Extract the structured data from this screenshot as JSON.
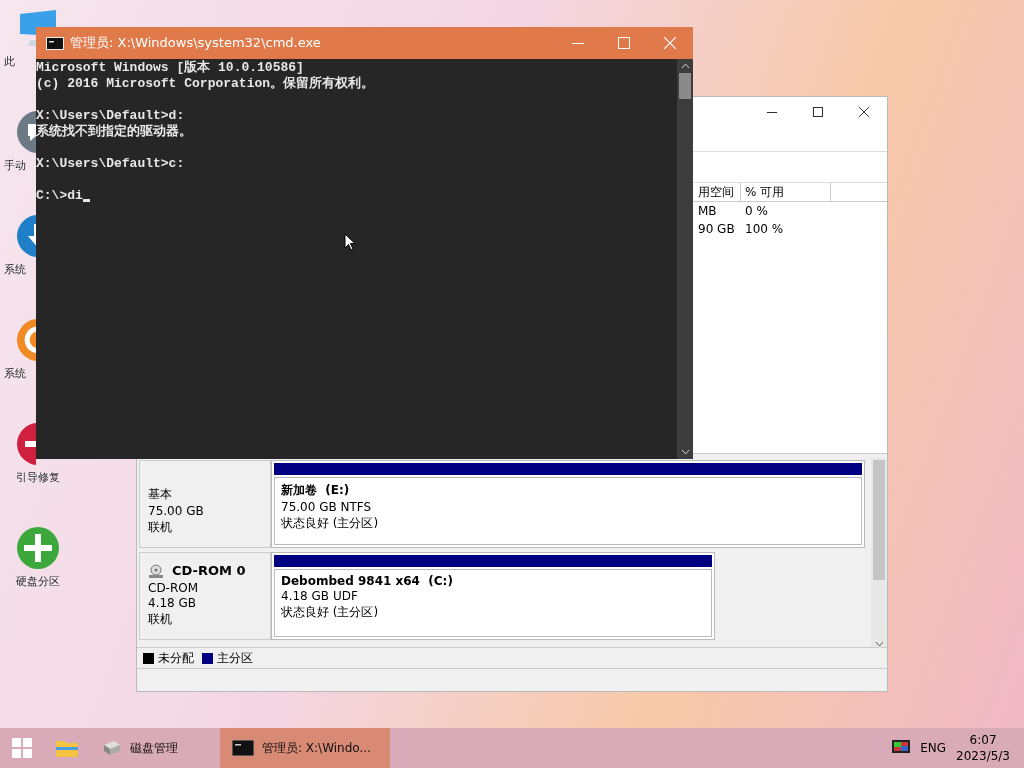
{
  "desktop_icons": [
    {
      "kind": "pc",
      "label": "此"
    },
    {
      "kind": "chat",
      "label": "手动"
    },
    {
      "kind": "download",
      "label": "系统"
    },
    {
      "kind": "backup",
      "label": "系统"
    },
    {
      "kind": "repair",
      "label": "引导修复"
    },
    {
      "kind": "partition",
      "label": "硬盘分区"
    }
  ],
  "disk_management": {
    "table": {
      "columns": [
        "用空间",
        "% 可用"
      ],
      "rows": [
        [
          "MB",
          "0 %"
        ],
        [
          "90 GB",
          "100 %"
        ]
      ]
    },
    "disks": [
      {
        "kind": "disk",
        "info": [
          "基本",
          "75.00 GB",
          "联机"
        ],
        "partition": {
          "name": "新加卷  (E:)",
          "size": "75.00 GB NTFS",
          "status": "状态良好 (主分区)"
        }
      },
      {
        "kind": "cdrom",
        "name": "CD-ROM 0",
        "info": [
          "CD-ROM",
          "4.18 GB",
          "联机"
        ],
        "partition": {
          "name": "Debombed 9841 x64  (C:)",
          "size": "4.18 GB UDF",
          "status": "状态良好 (主分区)"
        }
      }
    ],
    "legend": [
      {
        "label": "未分配",
        "color": "#000000"
      },
      {
        "label": "主分区",
        "color": "#000080"
      }
    ]
  },
  "cmd": {
    "title": "管理员: X:\\Windows\\system32\\cmd.exe",
    "blocks": [
      [
        "Microsoft Windows [版本 10.0.10586]",
        "(c) 2016 Microsoft Corporation。保留所有权利。"
      ],
      [
        "X:\\Users\\Default>d:",
        "系统找不到指定的驱动器。"
      ],
      [
        "X:\\Users\\Default>c:"
      ],
      [
        "C:\\>di"
      ]
    ]
  },
  "taskbar": {
    "items": [
      {
        "kind": "start"
      },
      {
        "kind": "explorer"
      },
      {
        "kind": "disk_app",
        "label": "磁盘管理",
        "selected": false
      },
      {
        "kind": "console_app",
        "label": "管理员: X:\\Windo...",
        "selected": true
      }
    ],
    "tray": {
      "language": "ENG",
      "time": "6:07",
      "date": "2023/5/3"
    }
  }
}
